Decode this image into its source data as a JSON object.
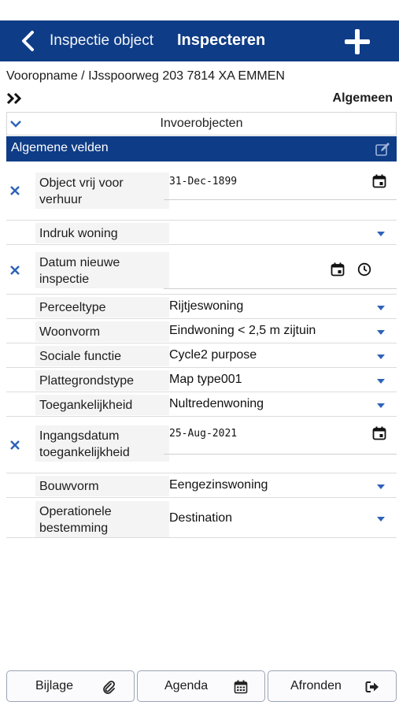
{
  "header": {
    "back_label": "Inspectie object",
    "title": "Inspecteren",
    "add_icon": "plus-icon",
    "background": "#0f3c86"
  },
  "address": "Vooropname / IJsspoorweg 203  7814 XA EMMEN",
  "section_label": "Algemeen",
  "subheader": "Invoerobjecten",
  "group": {
    "title": "Algemene velden",
    "edit_icon": "edit-icon"
  },
  "fields": [
    {
      "label": "Object vrij voor verhuur",
      "value": "31-Dec-1899",
      "kind": "date"
    },
    {
      "label": "Indruk woning",
      "value": "",
      "kind": "select"
    },
    {
      "label": "Datum nieuwe inspectie",
      "value": "",
      "kind": "datetime"
    },
    {
      "label": "Perceeltype",
      "value": "Rijtjeswoning",
      "kind": "select"
    },
    {
      "label": "Woonvorm",
      "value": "Eindwoning < 2,5 m zijtuin",
      "kind": "select"
    },
    {
      "label": "Sociale functie",
      "value": "Cycle2 purpose",
      "kind": "select"
    },
    {
      "label": "Plattegrondstype",
      "value": "Map type001",
      "kind": "select"
    },
    {
      "label": "Toegankelijkheid",
      "value": "Nultredenwoning",
      "kind": "select"
    },
    {
      "label": "Ingangsdatum toegankelijkheid",
      "value": "25-Aug-2021",
      "kind": "date"
    },
    {
      "label": "Bouwvorm",
      "value": "Eengezinswoning",
      "kind": "select"
    },
    {
      "label": "Operationele bestemming",
      "value": "Destination",
      "kind": "select"
    }
  ],
  "footer": {
    "attach": "Bijlage",
    "agenda": "Agenda",
    "finish": "Afronden"
  },
  "colors": {
    "primary": "#0f3c86",
    "accent": "#2e63b8"
  }
}
